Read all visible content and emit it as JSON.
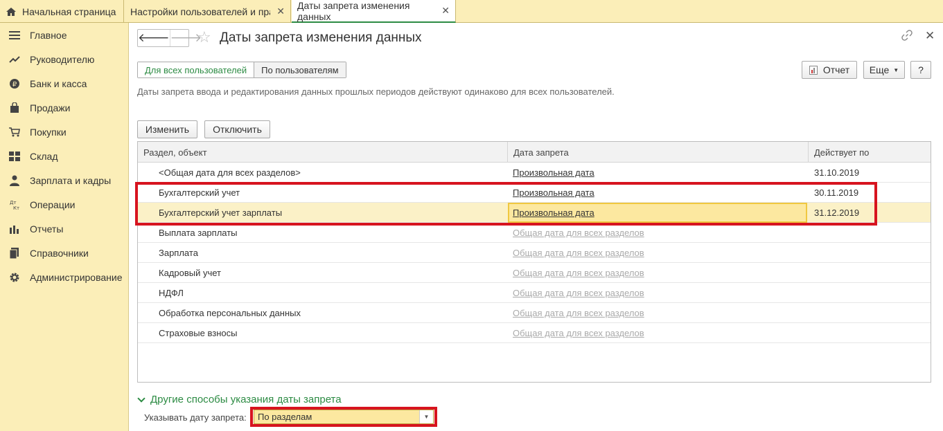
{
  "tabs": [
    {
      "label": "Начальная страница"
    },
    {
      "label": "Настройки пользователей и прав"
    },
    {
      "label": "Даты запрета изменения данных"
    }
  ],
  "sidebar": {
    "items": [
      {
        "label": "Главное",
        "icon": "menu-icon"
      },
      {
        "label": "Руководителю",
        "icon": "trend-icon"
      },
      {
        "label": "Банк и касса",
        "icon": "ruble-icon"
      },
      {
        "label": "Продажи",
        "icon": "bag-icon"
      },
      {
        "label": "Покупки",
        "icon": "cart-icon"
      },
      {
        "label": "Склад",
        "icon": "grid-icon"
      },
      {
        "label": "Зарплата и кадры",
        "icon": "person-icon"
      },
      {
        "label": "Операции",
        "icon": "dt-kt-icon"
      },
      {
        "label": "Отчеты",
        "icon": "bar-chart-icon"
      },
      {
        "label": "Справочники",
        "icon": "book-icon"
      },
      {
        "label": "Администрирование",
        "icon": "gear-icon"
      }
    ]
  },
  "header": {
    "title": "Даты запрета изменения данных"
  },
  "mode": {
    "all_users": "Для всех пользователей",
    "by_users": "По пользователям"
  },
  "toolbar": {
    "report": "Отчет",
    "more": "Еще",
    "help": "?",
    "change": "Изменить",
    "disable": "Отключить"
  },
  "hint": "Даты запрета ввода и редактирования данных прошлых периодов действуют одинаково для всех пользователей.",
  "table": {
    "columns": [
      "Раздел, объект",
      "Дата запрета",
      "Действует по"
    ],
    "rows": [
      {
        "section": "<Общая дата для всех разделов>",
        "date": "Произвольная дата",
        "until": "31.10.2019",
        "muted": false
      },
      {
        "section": "Бухгалтерский учет",
        "date": "Произвольная дата",
        "until": "30.11.2019",
        "muted": false
      },
      {
        "section": "Бухгалтерский учет зарплаты",
        "date": "Произвольная дата",
        "until": "31.12.2019",
        "muted": false
      },
      {
        "section": "Выплата зарплаты",
        "date": "Общая дата для всех разделов",
        "until": "",
        "muted": true
      },
      {
        "section": "Зарплата",
        "date": "Общая дата для всех разделов",
        "until": "",
        "muted": true
      },
      {
        "section": "Кадровый учет",
        "date": "Общая дата для всех разделов",
        "until": "",
        "muted": true
      },
      {
        "section": "НДФЛ",
        "date": "Общая дата для всех разделов",
        "until": "",
        "muted": true
      },
      {
        "section": "Обработка персональных данных",
        "date": "Общая дата для всех разделов",
        "until": "",
        "muted": true
      },
      {
        "section": "Страховые взносы",
        "date": "Общая дата для всех разделов",
        "until": "",
        "muted": true
      }
    ]
  },
  "other": {
    "title": "Другие способы указания даты запрета",
    "field_label": "Указывать дату запрета:",
    "field_value": "По разделам"
  },
  "colors": {
    "accent": "#2c8b43",
    "highlight_box": "#d7141f",
    "sidebar_bg": "#fbeeb8",
    "selected_row": "#fbf1c7"
  }
}
